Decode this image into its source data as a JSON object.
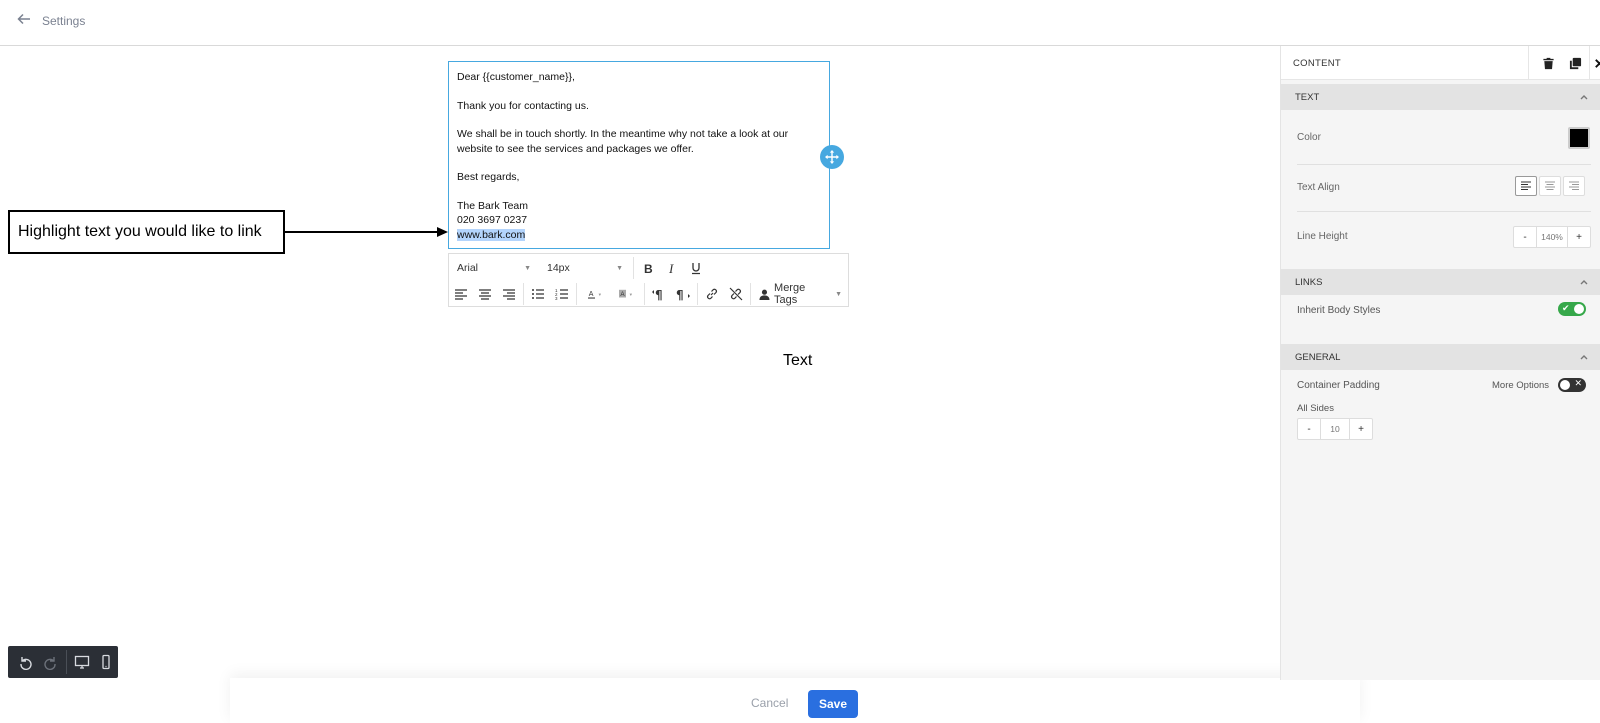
{
  "header": {
    "back_label": "Settings"
  },
  "editor": {
    "greeting": "Dear {{customer_name}},",
    "line1": "Thank you for contacting us.",
    "line2a": "We shall be in touch shortly. In the meantime why not take a look at our",
    "line2b": "website to see the services and packages we offer.",
    "closing": "Best regards,",
    "sig_name": "The Bark Team",
    "sig_phone": "020 3697 0237",
    "sig_web": "www.bark.com"
  },
  "toolbar": {
    "font_family": "Arial",
    "font_size": "14px",
    "merge_tags_label": "Merge Tags"
  },
  "annotation": {
    "callout_text": "Highlight text you would like to link"
  },
  "canvas": {
    "label": "Text"
  },
  "footer": {
    "cancel_label": "Cancel",
    "save_label": "Save"
  },
  "panel": {
    "title": "CONTENT",
    "sections": {
      "text": "TEXT",
      "links": "LINKS",
      "general": "GENERAL"
    },
    "color_label": "Color",
    "color_value": "#000000",
    "text_align_label": "Text Align",
    "text_align_value": "left",
    "line_height_label": "Line Height",
    "line_height_value": "140%",
    "inherit_body_styles_label": "Inherit Body Styles",
    "inherit_body_styles_on": true,
    "container_padding_label": "Container Padding",
    "more_options_label": "More Options",
    "more_options_on": false,
    "all_sides_label": "All Sides",
    "padding_value": "10",
    "minus": "-",
    "plus": "+"
  },
  "colors": {
    "accent_blue": "#2a6fe0",
    "selection_border": "#46a8e0",
    "toggle_green": "#36a84a"
  }
}
